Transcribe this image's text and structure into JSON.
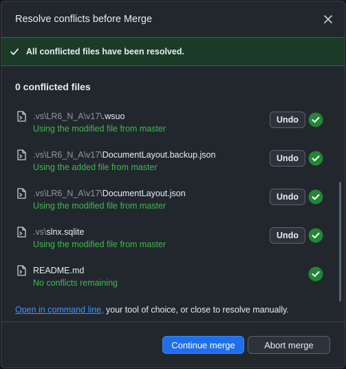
{
  "dialog": {
    "title": "Resolve conflicts before Merge",
    "close_icon": "close-icon"
  },
  "banner": {
    "icon": "check-icon",
    "text": "All conflicted files have been resolved."
  },
  "summary": {
    "heading": "0 conflicted files"
  },
  "files": [
    {
      "dir": ".vs\\LR6_N_A\\v17\\",
      "name": ".wsuo",
      "status": "Using the modified file from master",
      "undo_label": "Undo",
      "has_undo": true
    },
    {
      "dir": ".vs\\LR6_N_A\\v17\\",
      "name": "DocumentLayout.backup.json",
      "status": "Using the added file from master",
      "undo_label": "Undo",
      "has_undo": true
    },
    {
      "dir": ".vs\\LR6_N_A\\v17\\",
      "name": "DocumentLayout.json",
      "status": "Using the modified file from master",
      "undo_label": "Undo",
      "has_undo": true
    },
    {
      "dir": ".vs\\",
      "name": "slnx.sqlite",
      "status": "Using the modified file from master",
      "undo_label": "Undo",
      "has_undo": true
    },
    {
      "dir": "",
      "name": "README.md",
      "status": "No conflicts remaining",
      "undo_label": "",
      "has_undo": false
    }
  ],
  "footnote": {
    "link_text": "Open in command line,",
    "rest_text": " your tool of choice, or close to resolve manually."
  },
  "actions": {
    "continue_label": "Continue merge",
    "abort_label": "Abort merge"
  },
  "colors": {
    "accent": "#1f6feb",
    "success": "#3fb950",
    "success_fill": "#238636",
    "link": "#4493f8"
  }
}
